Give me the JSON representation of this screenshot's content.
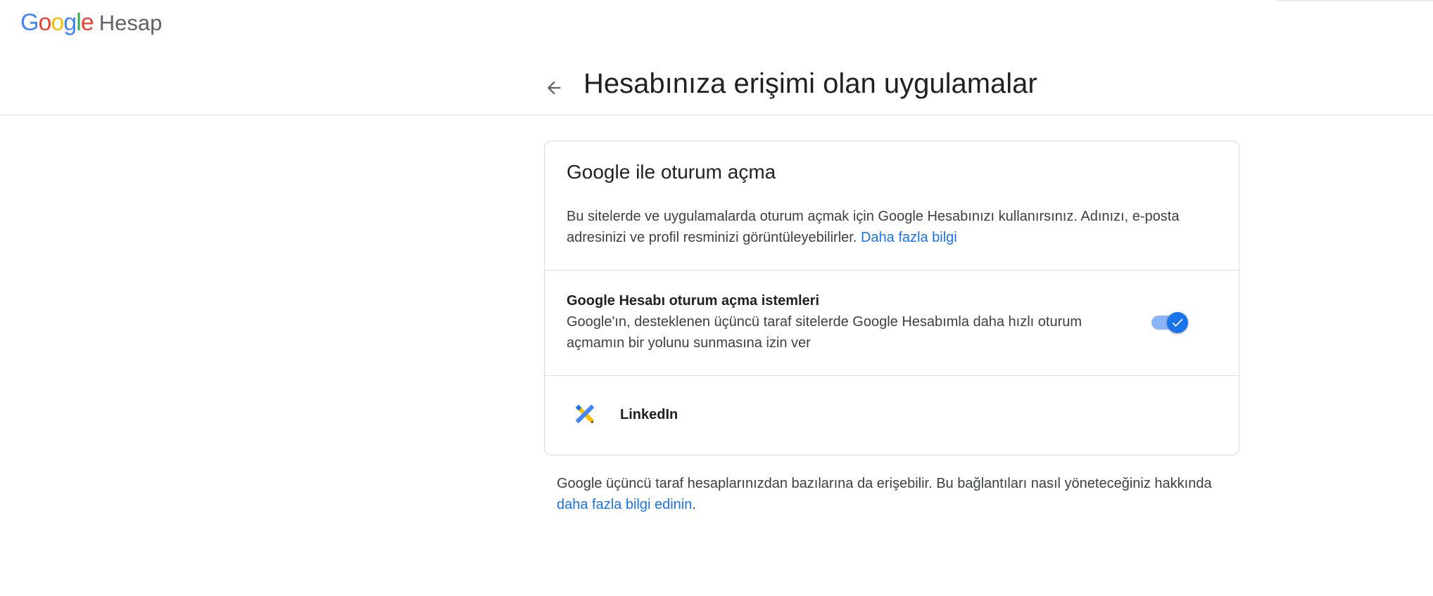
{
  "header": {
    "logo_google": [
      "G",
      "o",
      "o",
      "g",
      "l",
      "e"
    ],
    "logo_product": "Hesap",
    "page_title": "Hesabınıza erişimi olan uygulamalar",
    "back_icon": "arrow-back-icon"
  },
  "card": {
    "title": "Google ile oturum açma",
    "description": "Bu sitelerde ve uygulamalarda oturum açmak için Google Hesabınızı kullanırsınız. Adınızı, e-posta adresinizi ve profil resminizi görüntüleyebilirler.",
    "learn_more_link": "Daha fazla bilgi",
    "setting": {
      "title": "Google Hesabı oturum açma istemleri",
      "description": "Google'ın, desteklenen üçüncü taraf sitelerde Google Hesabımla daha hızlı oturum açmamın bir yolunu sunmasına izin ver",
      "toggle_on": true,
      "toggle_icon": "check-icon"
    },
    "apps": [
      {
        "name": "LinkedIn",
        "icon": "tools-icon"
      }
    ]
  },
  "footer": {
    "text": "Google üçüncü taraf hesaplarınızdan bazılarına da erişebilir. Bu bağlantıları nasıl yöneteceğiniz hakkında",
    "link": "daha fazla bilgi edinin",
    "suffix": "."
  },
  "colors": {
    "accent": "#1a73e8",
    "toggle_track": "#8ab4f8",
    "divider": "#dadce0"
  }
}
